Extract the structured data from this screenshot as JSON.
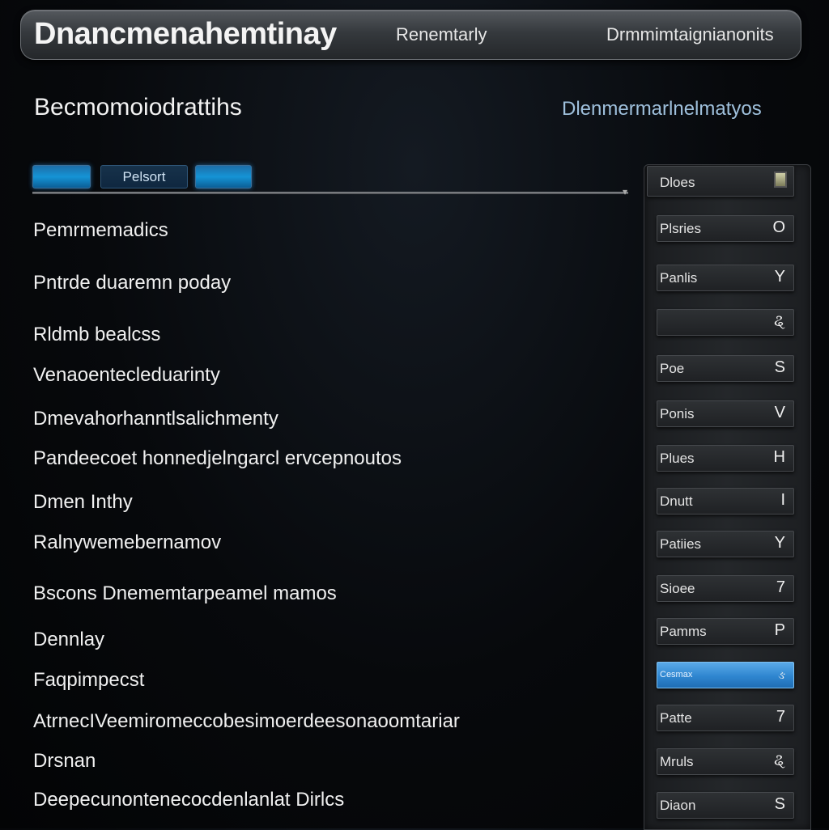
{
  "header": {
    "title": "Dnancmenahemtinay",
    "subtitle": "Renemtarly",
    "right_label": "Drmmimtaignianonits"
  },
  "section": {
    "title": "Becmomoiodrattihs",
    "link": "Dlenmermarlnelmatyos"
  },
  "tabs": [
    {
      "label": ""
    },
    {
      "label": "Pelsort"
    },
    {
      "label": ""
    }
  ],
  "items": [
    "Pemrmemadics",
    "Pntrde duaremn poday",
    "Rldmb bealcss",
    "Venaoentecleduarinty",
    "Dmevahorhanntlsalichmenty",
    "Pandeecoet honnedjelngarcl ervcepnoutos",
    "Dmen Inthy",
    "Ralnywemebernamov",
    "Bscons Dnememtarpeamel mamos",
    "Dennlay",
    "Faqpimpecst",
    "AtrnecIVeemiromeccobesimoerdeesonaoomtariar",
    "Drsnan",
    "Deepecunontenecocdenlanlat Dirlcs"
  ],
  "panel": {
    "rows": [
      {
        "label": "Dloes",
        "value": ""
      },
      {
        "label": "Plsries",
        "value": "O"
      },
      {
        "label": "Panlis",
        "value": "Y"
      },
      {
        "label": "",
        "value": "ୡ"
      },
      {
        "label": "Poe",
        "value": "S"
      },
      {
        "label": "Ponis",
        "value": "V"
      },
      {
        "label": "Plues",
        "value": "H"
      },
      {
        "label": "Dnutt",
        "value": "I"
      },
      {
        "label": "Patiies",
        "value": "Y"
      },
      {
        "label": "Sioee",
        "value": "7"
      },
      {
        "label": "Pamms",
        "value": "P"
      },
      {
        "label": "Cesmax",
        "value": "ઙ"
      },
      {
        "label": "Patte",
        "value": "7"
      },
      {
        "label": "Mruls",
        "value": "ୡ"
      },
      {
        "label": "Diaon",
        "value": "S"
      }
    ],
    "active_index": 11
  },
  "colors": {
    "accent_blue": "#1594d6",
    "active_row": "#2f86d0",
    "background": "#07090c"
  }
}
